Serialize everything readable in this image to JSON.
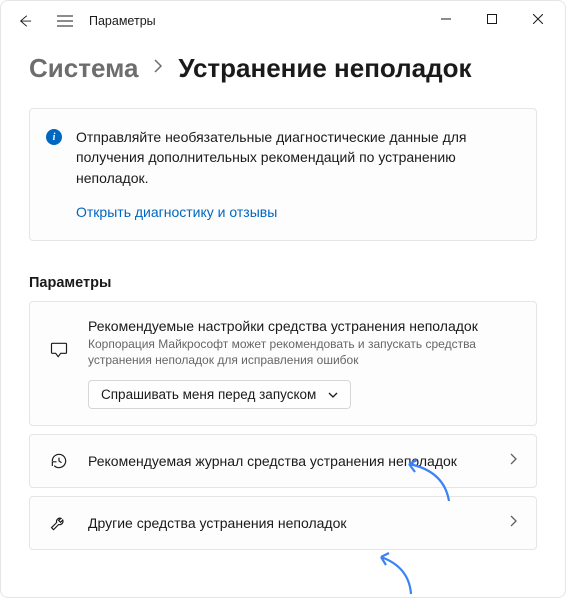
{
  "titlebar": {
    "title": "Параметры"
  },
  "breadcrumb": {
    "parent": "Система",
    "current": "Устранение неполадок"
  },
  "info": {
    "text": "Отправляйте необязательные диагностические данные для получения дополнительных рекомендаций по устранению неполадок.",
    "link": "Открыть диагностику и отзывы"
  },
  "section": {
    "heading": "Параметры"
  },
  "recommended": {
    "title": "Рекомендуемые настройки средства устранения неполадок",
    "desc": "Корпорация Майкрософт может рекомендовать и запускать средства устранения неполадок для исправления ошибок",
    "dropdown": "Спрашивать меня перед запуском"
  },
  "history": {
    "title": "Рекомендуемая журнал средства устранения неполадок"
  },
  "other": {
    "title": "Другие средства устранения неполадок"
  },
  "colors": {
    "accent": "#0067c0",
    "arrow": "#3b82f6"
  }
}
